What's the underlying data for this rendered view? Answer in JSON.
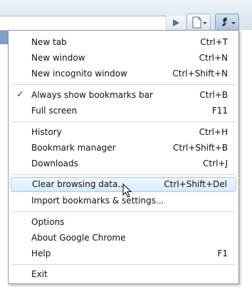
{
  "toolbar": {
    "go_icon": "play-arrow-icon",
    "page_menu_icon": "page-icon",
    "wrench_menu_icon": "wrench-icon",
    "dropdown_icon": "chevron-down-icon"
  },
  "menu": {
    "items": [
      {
        "label": "New tab",
        "shortcut": "Ctrl+T"
      },
      {
        "label": "New window",
        "shortcut": "Ctrl+N"
      },
      {
        "label": "New incognito window",
        "shortcut": "Ctrl+Shift+N"
      },
      {
        "label": "Always show bookmarks bar",
        "shortcut": "Ctrl+B",
        "checked": true
      },
      {
        "label": "Full screen",
        "shortcut": "F11"
      },
      {
        "label": "History",
        "shortcut": "Ctrl+H"
      },
      {
        "label": "Bookmark manager",
        "shortcut": "Ctrl+Shift+B"
      },
      {
        "label": "Downloads",
        "shortcut": "Ctrl+J"
      },
      {
        "label": "Clear browsing data...",
        "shortcut": "Ctrl+Shift+Del",
        "hovered": true
      },
      {
        "label": "Import bookmarks & settings...",
        "shortcut": ""
      },
      {
        "label": "Options",
        "shortcut": ""
      },
      {
        "label": "About Google Chrome",
        "shortcut": ""
      },
      {
        "label": "Help",
        "shortcut": "F1"
      },
      {
        "label": "Exit",
        "shortcut": ""
      }
    ],
    "check_mark": "✓",
    "accent_color": "#dbeafc"
  }
}
